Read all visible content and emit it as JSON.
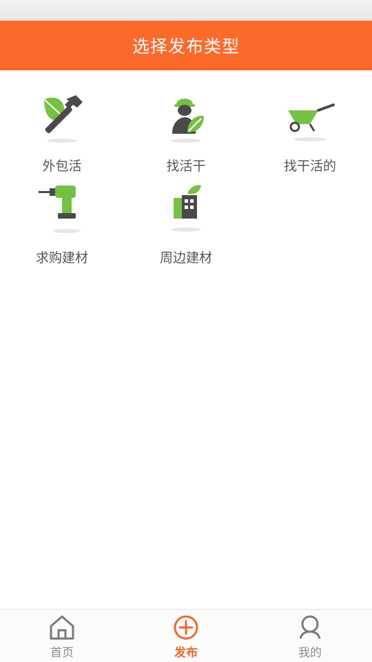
{
  "header": {
    "title": "选择发布类型"
  },
  "colors": {
    "accent": "#fd692a",
    "green": "#76c043",
    "dark": "#4f4f4f"
  },
  "grid": {
    "items": [
      {
        "label": "外包活",
        "icon": "hammer-leaf-icon"
      },
      {
        "label": "找活干",
        "icon": "worker-helmet-icon"
      },
      {
        "label": "找干活的",
        "icon": "wheelbarrow-icon"
      },
      {
        "label": "求购建材",
        "icon": "power-drill-icon"
      },
      {
        "label": "周边建材",
        "icon": "building-leaf-icon"
      }
    ]
  },
  "tabbar": {
    "items": [
      {
        "label": "首页",
        "icon": "home-icon",
        "active": false
      },
      {
        "label": "发布",
        "icon": "plus-circle-icon",
        "active": true
      },
      {
        "label": "我的",
        "icon": "user-icon",
        "active": false
      }
    ]
  }
}
